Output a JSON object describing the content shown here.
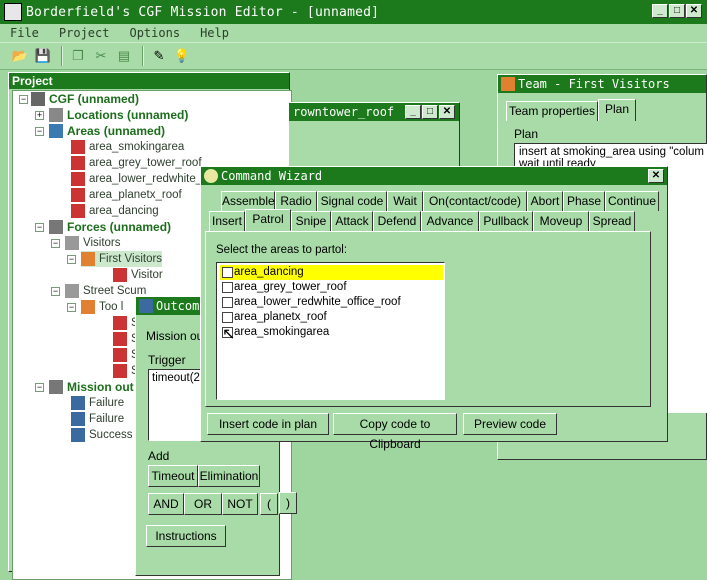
{
  "app": {
    "title": "Borderfield's CGF Mission Editor - [unnamed]"
  },
  "menu": {
    "file": "File",
    "project": "Project",
    "options": "Options",
    "help": "Help"
  },
  "toolbar": {
    "icons": [
      "open-folder-icon",
      "save-disk-icon",
      "copy-icon",
      "cut-icon",
      "paste-icon",
      "wizard-icon",
      "bulb-icon"
    ]
  },
  "project_panel": {
    "title": "Project",
    "tree": {
      "root": "CGF (unnamed)",
      "locations": "Locations (unnamed)",
      "areas": "Areas (unnamed)",
      "area_items": [
        "area_smokingarea",
        "area_grey_tower_roof",
        "area_lower_redwhite_o",
        "area_planetx_roof",
        "area_dancing"
      ],
      "forces": "Forces (unnamed)",
      "visitors": "Visitors",
      "first_visitors": "First Visitors",
      "visitor": "Visitor",
      "street_scum": "Street Scum",
      "too_l": "Too l",
      "s_items": [
        "S",
        "S",
        "S",
        "S"
      ],
      "mission_out": "Mission out",
      "outcomes": [
        "Failure",
        "Failure",
        "Success"
      ]
    }
  },
  "bg_window": {
    "title": "rowntower_roof"
  },
  "team_window": {
    "title": "Team - First Visitors",
    "tab_props": "Team properties",
    "tab_plan": "Plan",
    "plan_label": "Plan",
    "plan_text": "insert at smoking_area using \"colum",
    "plan_text2": "wait until ready"
  },
  "outcome_window": {
    "title": "Outcom",
    "mission_label": "Mission ou",
    "trigger_label": "Trigger",
    "trigger_value": "timeout(20",
    "add_label": "Add",
    "timeout_btn": "Timeout",
    "elimination_btn": "Elimination",
    "and_btn": "AND",
    "or_btn": "OR",
    "not_btn": "NOT",
    "lparen_btn": "(",
    "rparen_btn": ")",
    "instructions_btn": "Instructions"
  },
  "wizard": {
    "title": "Command Wizard",
    "tabs_row1": [
      "Assemble",
      "Radio",
      "Signal code",
      "Wait",
      "On(contact/code)",
      "Abort",
      "Phase",
      "Continue"
    ],
    "tabs_row2": [
      "Insert",
      "Patrol",
      "Snipe",
      "Attack",
      "Defend",
      "Advance",
      "Pullback",
      "Moveup",
      "Spread"
    ],
    "prompt": "Select the areas to partol:",
    "areas": [
      "area_dancing",
      "area_grey_tower_roof",
      "area_lower_redwhite_office_roof",
      "area_planetx_roof",
      "area_smokingarea"
    ],
    "insert_btn": "Insert code in plan",
    "copy_btn": "Copy code to Clipboard",
    "preview_btn": "Preview code"
  }
}
